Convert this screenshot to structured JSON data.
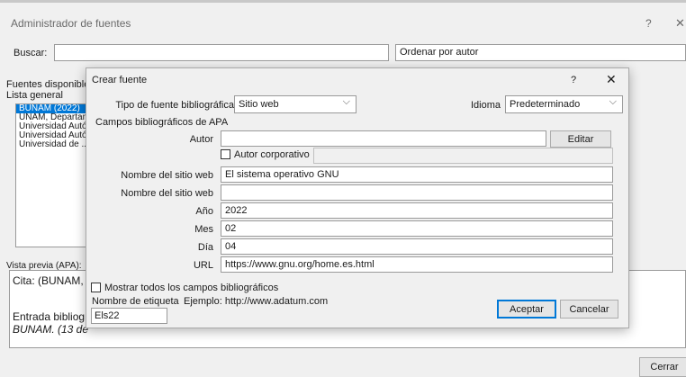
{
  "background_window": {
    "title": "Administrador de fuentes",
    "help_label": "?",
    "close_label": "✕",
    "search_label": "Buscar:",
    "search_value": "",
    "sort_label": "Ordenar por autor",
    "available_label": "Fuentes disponibles en:",
    "list_label": "Lista general",
    "sources": [
      "BUNAM (2022)",
      "UNAM, Departamento...",
      "Universidad Autónoma...",
      "Universidad Autónoma...",
      "Universidad de ..."
    ],
    "preview_label": "Vista previa (APA):",
    "preview_cita": "Cita:  (BUNAM,",
    "preview_entrada": "Entrada bibliog",
    "preview_bunam": "BUNAM. (13 de",
    "close_button": "Cerrar"
  },
  "dialog": {
    "title": "Crear fuente",
    "help_label": "?",
    "close_label": "✕",
    "source_type_label": "Tipo de fuente bibliográfica",
    "source_type_value": "Sitio web",
    "language_label": "Idioma",
    "language_value": "Predeterminado",
    "section_title": "Campos bibliográficos de APA",
    "author_label": "Autor",
    "author_value": "",
    "edit_button": "Editar",
    "corporate_author_label": "Autor corporativo",
    "corporate_author_checked": false,
    "fields": [
      {
        "label": "Nombre del sitio web",
        "value": "El sistema operativo GNU"
      },
      {
        "label": "Nombre del sitio web",
        "value": ""
      },
      {
        "label": "Año",
        "value": "2022"
      },
      {
        "label": "Mes",
        "value": "02"
      },
      {
        "label": "Día",
        "value": "04"
      },
      {
        "label": "URL",
        "value": "https://www.gnu.org/home.es.html"
      }
    ],
    "show_all_label": "Mostrar todos los campos bibliográficos",
    "show_all_checked": false,
    "tag_name_label": "Nombre de etiqueta",
    "tag_example": "Ejemplo: http://www.adatum.com",
    "tag_value": "Els22",
    "accept_button": "Aceptar",
    "cancel_button": "Cancelar"
  }
}
